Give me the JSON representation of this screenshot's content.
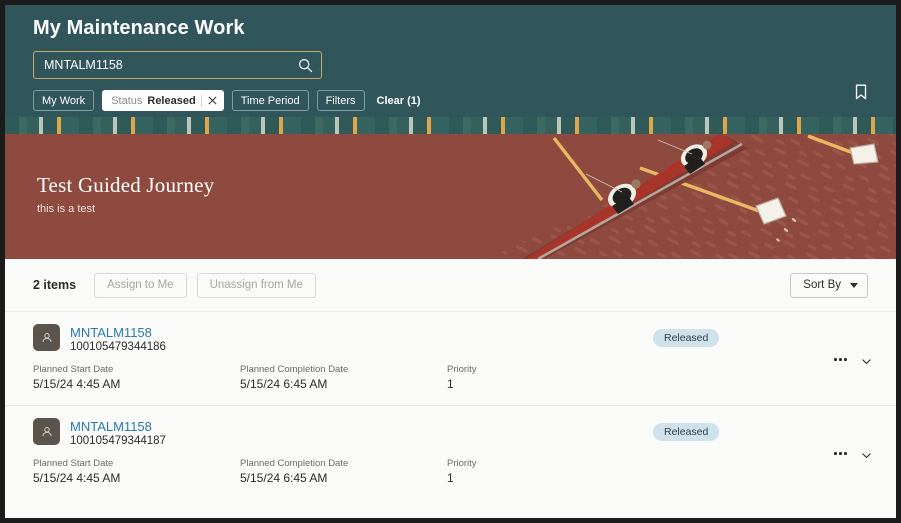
{
  "header": {
    "title": "My Maintenance Work",
    "search": {
      "value": "MNTALM1158",
      "placeholder": "Search",
      "icon": "search-icon"
    },
    "bookmark_icon": "bookmark-icon",
    "chips": [
      {
        "label": "My Work",
        "active": false
      },
      {
        "key": "Status",
        "value": "Released",
        "active": true,
        "remove_icon": "close-icon"
      },
      {
        "label": "Time Period",
        "active": false
      },
      {
        "label": "Filters",
        "active": false
      }
    ],
    "clear_label": "Clear (1)"
  },
  "banner": {
    "title": "Test Guided Journey",
    "subtitle": "this is a test",
    "background_color": "#8e4a3e",
    "art": "rowing-scull-illustration"
  },
  "toolbar": {
    "item_count": "2 items",
    "assign_label": "Assign to Me",
    "unassign_label": "Unassign from Me",
    "sort_label": "Sort By"
  },
  "list": {
    "labels": {
      "start": "Planned Start Date",
      "completion": "Planned Completion Date",
      "priority": "Priority"
    },
    "rows": [
      {
        "name": "MNTALM1158",
        "id": "100105479344186",
        "status": "Released",
        "start": "5/15/24 4:45 AM",
        "completion": "5/15/24 6:45 AM",
        "priority": "1"
      },
      {
        "name": "MNTALM1158",
        "id": "100105479344187",
        "status": "Released",
        "start": "5/15/24 4:45 AM",
        "completion": "5/15/24 6:45 AM",
        "priority": "1"
      }
    ]
  },
  "colors": {
    "header_teal": "#30565c",
    "banner_red": "#8e4a3e",
    "link_blue": "#2a7ab0",
    "badge_blue": "#cfe2ec",
    "search_border_gold": "#c8a86b"
  }
}
